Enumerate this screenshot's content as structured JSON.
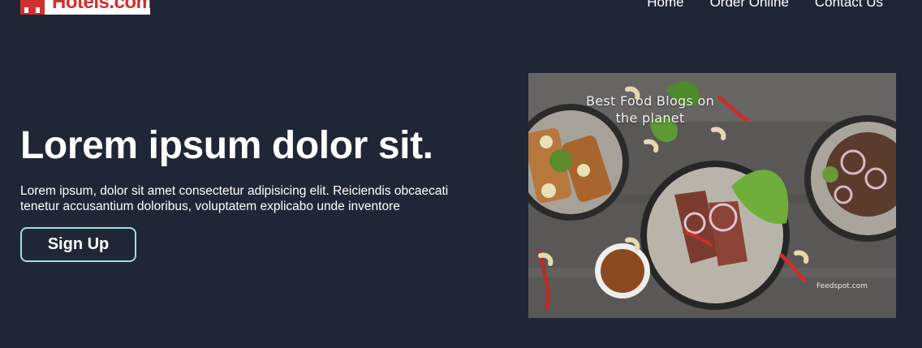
{
  "header": {
    "logo_text": "Hotels.com",
    "nav": [
      {
        "label": "Home"
      },
      {
        "label": "Order Online"
      },
      {
        "label": "Contact Us"
      }
    ]
  },
  "hero": {
    "title": "Lorem ipsum dolor sit.",
    "description": "Lorem ipsum, dolor sit amet consectetur adipisicing elit. Reiciendis obcaecati tenetur accusantium doloribus, voluptatem explicabo unde inventore",
    "cta_label": "Sign Up"
  },
  "image": {
    "caption": "Best Food Blogs on the planet",
    "credit": "Feedspot.com"
  },
  "colors": {
    "background": "#1f2736",
    "brand_red": "#d32f2f",
    "button_border": "#a9d8e4",
    "text": "#ffffff"
  }
}
